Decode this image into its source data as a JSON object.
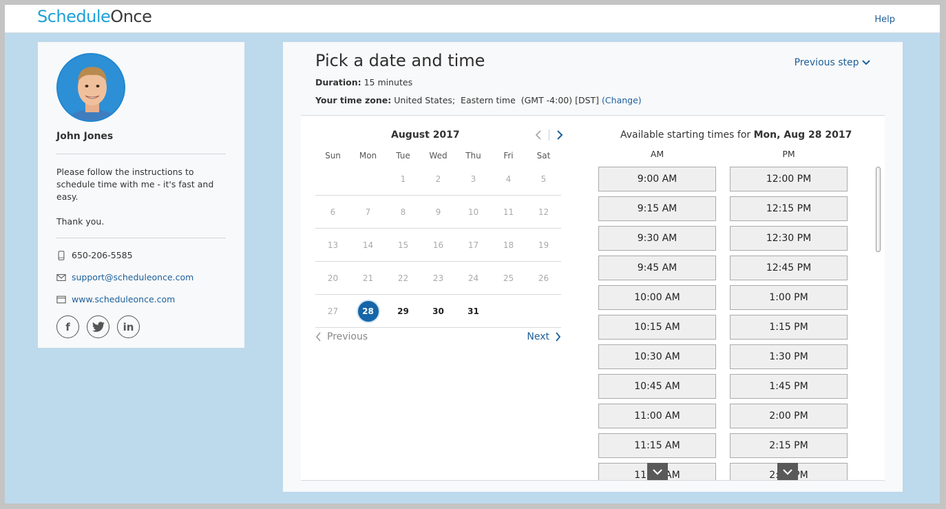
{
  "header": {
    "logo_part1": "Schedule",
    "logo_part2": "Once",
    "help_label": "Help"
  },
  "profile": {
    "name": "John Jones",
    "description": "Please follow the instructions to schedule time with me - it's fast and easy.",
    "thanks": "Thank you.",
    "phone": "650-206-5585",
    "email": "support@scheduleonce.com",
    "website": "www.scheduleonce.com",
    "social": [
      "f",
      "twitter",
      "in"
    ]
  },
  "main": {
    "title": "Pick a date and time",
    "previous_step": "Previous step",
    "duration_label": "Duration:",
    "duration_value": "15 minutes",
    "timezone_label": "Your time zone:",
    "timezone_value": "United States;  Eastern time  (GMT -4:00) [DST]",
    "timezone_change": "(Change)"
  },
  "calendar": {
    "month": "August 2017",
    "weekdays": [
      "Sun",
      "Mon",
      "Tue",
      "Wed",
      "Thu",
      "Fri",
      "Sat"
    ],
    "weeks": [
      [
        "",
        "",
        "1",
        "2",
        "3",
        "4",
        "5"
      ],
      [
        "6",
        "7",
        "8",
        "9",
        "10",
        "11",
        "12"
      ],
      [
        "13",
        "14",
        "15",
        "16",
        "17",
        "18",
        "19"
      ],
      [
        "20",
        "21",
        "22",
        "23",
        "24",
        "25",
        "26"
      ],
      [
        "27",
        "28",
        "29",
        "30",
        "31",
        "",
        ""
      ]
    ],
    "available": [
      "29",
      "30",
      "31"
    ],
    "selected": "28",
    "prev_label": "Previous",
    "next_label": "Next"
  },
  "times": {
    "title_prefix": "Available starting times for",
    "title_date": "Mon, Aug 28 2017",
    "am_label": "AM",
    "pm_label": "PM",
    "am": [
      "9:00 AM",
      "9:15 AM",
      "9:30 AM",
      "9:45 AM",
      "10:00 AM",
      "10:15 AM",
      "10:30 AM",
      "10:45 AM",
      "11:00 AM",
      "11:15 AM",
      "11:30 AM"
    ],
    "pm": [
      "12:00 PM",
      "12:15 PM",
      "12:30 PM",
      "12:45 PM",
      "1:00 PM",
      "1:15 PM",
      "1:30 PM",
      "1:45 PM",
      "2:00 PM",
      "2:15 PM",
      "2:30 PM"
    ]
  },
  "colors": {
    "accent": "#1565a8",
    "link": "#1d5f99",
    "background": "#bdd9ec"
  }
}
